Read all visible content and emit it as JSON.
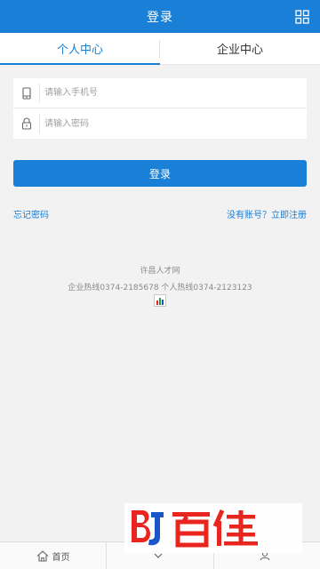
{
  "header": {
    "title": "登录"
  },
  "tabs": [
    {
      "label": "个人中心",
      "active": true
    },
    {
      "label": "企业中心",
      "active": false
    }
  ],
  "form": {
    "phone_placeholder": "请输入手机号",
    "password_placeholder": "请输入密码"
  },
  "login_button": "登录",
  "links": {
    "forgot": "忘记密码",
    "register": "没有账号？立即注册"
  },
  "site_info": {
    "name": "许昌人才网",
    "hotline": "企业热线0374-2185678 个人热线0374-2123123"
  },
  "bottom_nav": [
    {
      "label": "首页",
      "icon": "home-icon"
    },
    {
      "label": "",
      "icon": "chevron-icon"
    },
    {
      "label": "",
      "icon": "person-icon"
    }
  ],
  "watermark": {
    "text": "BJ百佳",
    "color_primary": "#e8251f",
    "color_secondary": "#1a56c9"
  },
  "colors": {
    "accent": "#1a7fd6",
    "background": "#f2f2f2"
  }
}
